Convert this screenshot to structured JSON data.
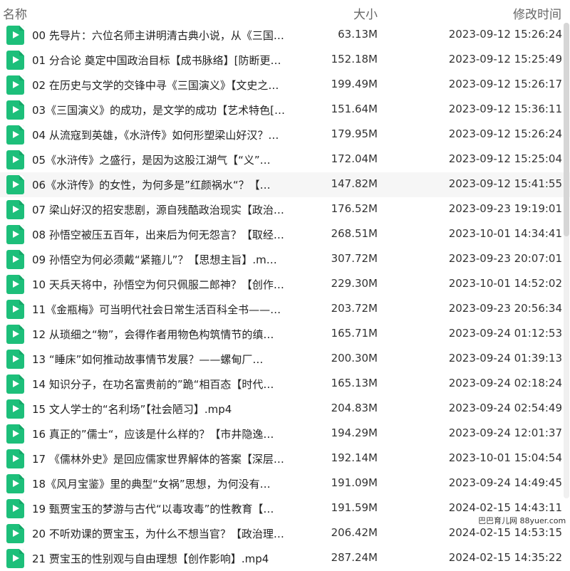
{
  "header": {
    "name_label": "名称",
    "size_label": "大小",
    "time_label": "修改时间"
  },
  "files": [
    {
      "name": "00 先导片：六位名师主讲明清古典小说，从《三国…",
      "size": "63.13M",
      "modified": "2023-09-12 15:26:24"
    },
    {
      "name": "01 分合论 奠定中国政治目标【成书脉络】[防断更…",
      "size": "152.18M",
      "modified": "2023-09-12 15:25:49"
    },
    {
      "name": "02 在历史与文学的交锋中寻《三国演义》【文史之…",
      "size": "199.49M",
      "modified": "2023-09-12 15:26:17"
    },
    {
      "name": "03《三国演义》的成功，是文学的成功【艺术特色[…",
      "size": "151.64M",
      "modified": "2023-09-12 15:36:11"
    },
    {
      "name": "04 从流寇到英雄，《水浒传》如何形塑梁山好汉？…",
      "size": "179.95M",
      "modified": "2023-09-12 15:26:24"
    },
    {
      "name": "05《水浒传》之盛行，是因为这股江湖气【“义”…",
      "size": "172.04M",
      "modified": "2023-09-12 15:25:04"
    },
    {
      "name": "06《水浒传》的女性，为何多是”红颜祸水“？【…",
      "size": "147.82M",
      "modified": "2023-09-12 15:41:55"
    },
    {
      "name": "07 梁山好汉的招安悲剧，源自残酷政治现实【政治…",
      "size": "176.52M",
      "modified": "2023-09-23 19:19:01"
    },
    {
      "name": "08 孙悟空被压五百年，出来后为何无怨言？【取经…",
      "size": "268.51M",
      "modified": "2023-10-01 14:34:41"
    },
    {
      "name": "09 孙悟空为何必须戴“紧箍儿”？【思想主旨】.m…",
      "size": "307.72M",
      "modified": "2023-09-23 20:07:01"
    },
    {
      "name": "10 天兵天将中，孙悟空为何只佩服二郎神？【创作…",
      "size": "229.30M",
      "modified": "2023-10-01 14:52:02"
    },
    {
      "name": "11《金瓶梅》可当明代社会日常生活百科全书——…",
      "size": "203.72M",
      "modified": "2023-09-23 20:56:34"
    },
    {
      "name": "12 从琐细之“物”，会得作者用物色构筑情节的缜…",
      "size": "165.71M",
      "modified": "2023-09-24 01:12:53"
    },
    {
      "name": "13 “睡床”如何推动故事情节发展？——螺甸厂…",
      "size": "200.30M",
      "modified": "2023-09-24 01:39:13"
    },
    {
      "name": "14 知识分子，在功名富贵前的”跪“相百态【时代…",
      "size": "165.13M",
      "modified": "2023-09-24 02:18:24"
    },
    {
      "name": "15 文人学士的“名利场”【社会陋习】.mp4",
      "size": "204.83M",
      "modified": "2023-09-24 02:54:49"
    },
    {
      "name": "16 真正的”儒士“，应该是什么样的？【市井隐逸…",
      "size": "194.29M",
      "modified": "2023-09-24 12:01:37"
    },
    {
      "name": "17 《儒林外史》是回应儒家世界解体的答案【深层…",
      "size": "192.14M",
      "modified": "2023-10-01 15:04:54"
    },
    {
      "name": "18《风月宝鉴》里的典型“女祸”思想，为何没有…",
      "size": "191.09M",
      "modified": "2023-09-24 14:49:45"
    },
    {
      "name": "19 甄贾宝玉的梦游与古代“以毒攻毒”的性教育【…",
      "size": "191.59M",
      "modified": "2024-02-15 14:43:11"
    },
    {
      "name": "20 不听劝课的贾宝玉，为什么不想当官？【政治理…",
      "size": "206.42M",
      "modified": "2024-02-15 14:53:15"
    },
    {
      "name": "21 贾宝玉的性别观与自由理想【创作影响】.mp4",
      "size": "287.24M",
      "modified": "2024-02-15 14:35:22"
    }
  ],
  "selected_index": 6,
  "watermark": "巴巴育儿网 88yuer.com",
  "colors": {
    "file_icon": "#1dbf7a",
    "header_text": "#666666",
    "row_selected": "#f6f6f6"
  }
}
